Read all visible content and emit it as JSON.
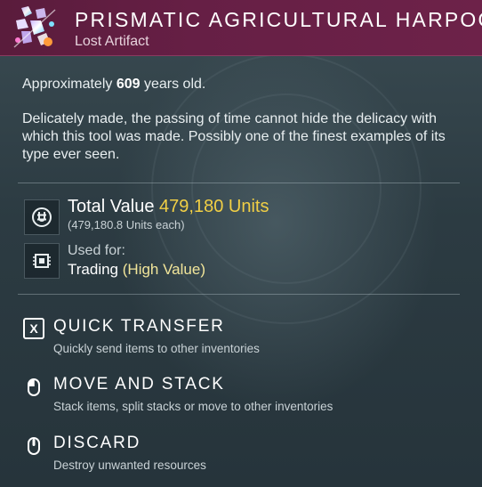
{
  "header": {
    "title": "PRISMATIC AGRICULTURAL HARPOON",
    "subtitle": "Lost Artifact",
    "icon": "prismatic-harpoon-icon"
  },
  "info": {
    "age_prefix": "Approximately ",
    "age_value": "609",
    "age_suffix": " years old.",
    "description": "Delicately made, the passing of time cannot hide the delicacy with which this tool was made. Possibly one of the finest examples of its type ever seen."
  },
  "value": {
    "label": "Total Value ",
    "amount": "479,180 Units",
    "each": "(479,180.8 Units each)",
    "icon": "units-currency-icon"
  },
  "usage": {
    "label": "Used for:",
    "value": "Trading",
    "qualifier": "(High Value)",
    "icon": "trading-chip-icon"
  },
  "actions": [
    {
      "title": "QUICK TRANSFER",
      "description": "Quickly send items to other inventories",
      "icon": "x-key-icon",
      "key": "X"
    },
    {
      "title": "MOVE AND STACK",
      "description": "Stack items, split stacks or move to other inventories",
      "icon": "left-mouse-button-icon"
    },
    {
      "title": "DISCARD",
      "description": "Destroy unwanted resources",
      "icon": "middle-mouse-button-icon"
    }
  ],
  "colors": {
    "header_bg": "#661f45",
    "value_amount": "#f1cf45",
    "high_value": "#f1e59a",
    "panel_bg": "#2c3b42"
  }
}
